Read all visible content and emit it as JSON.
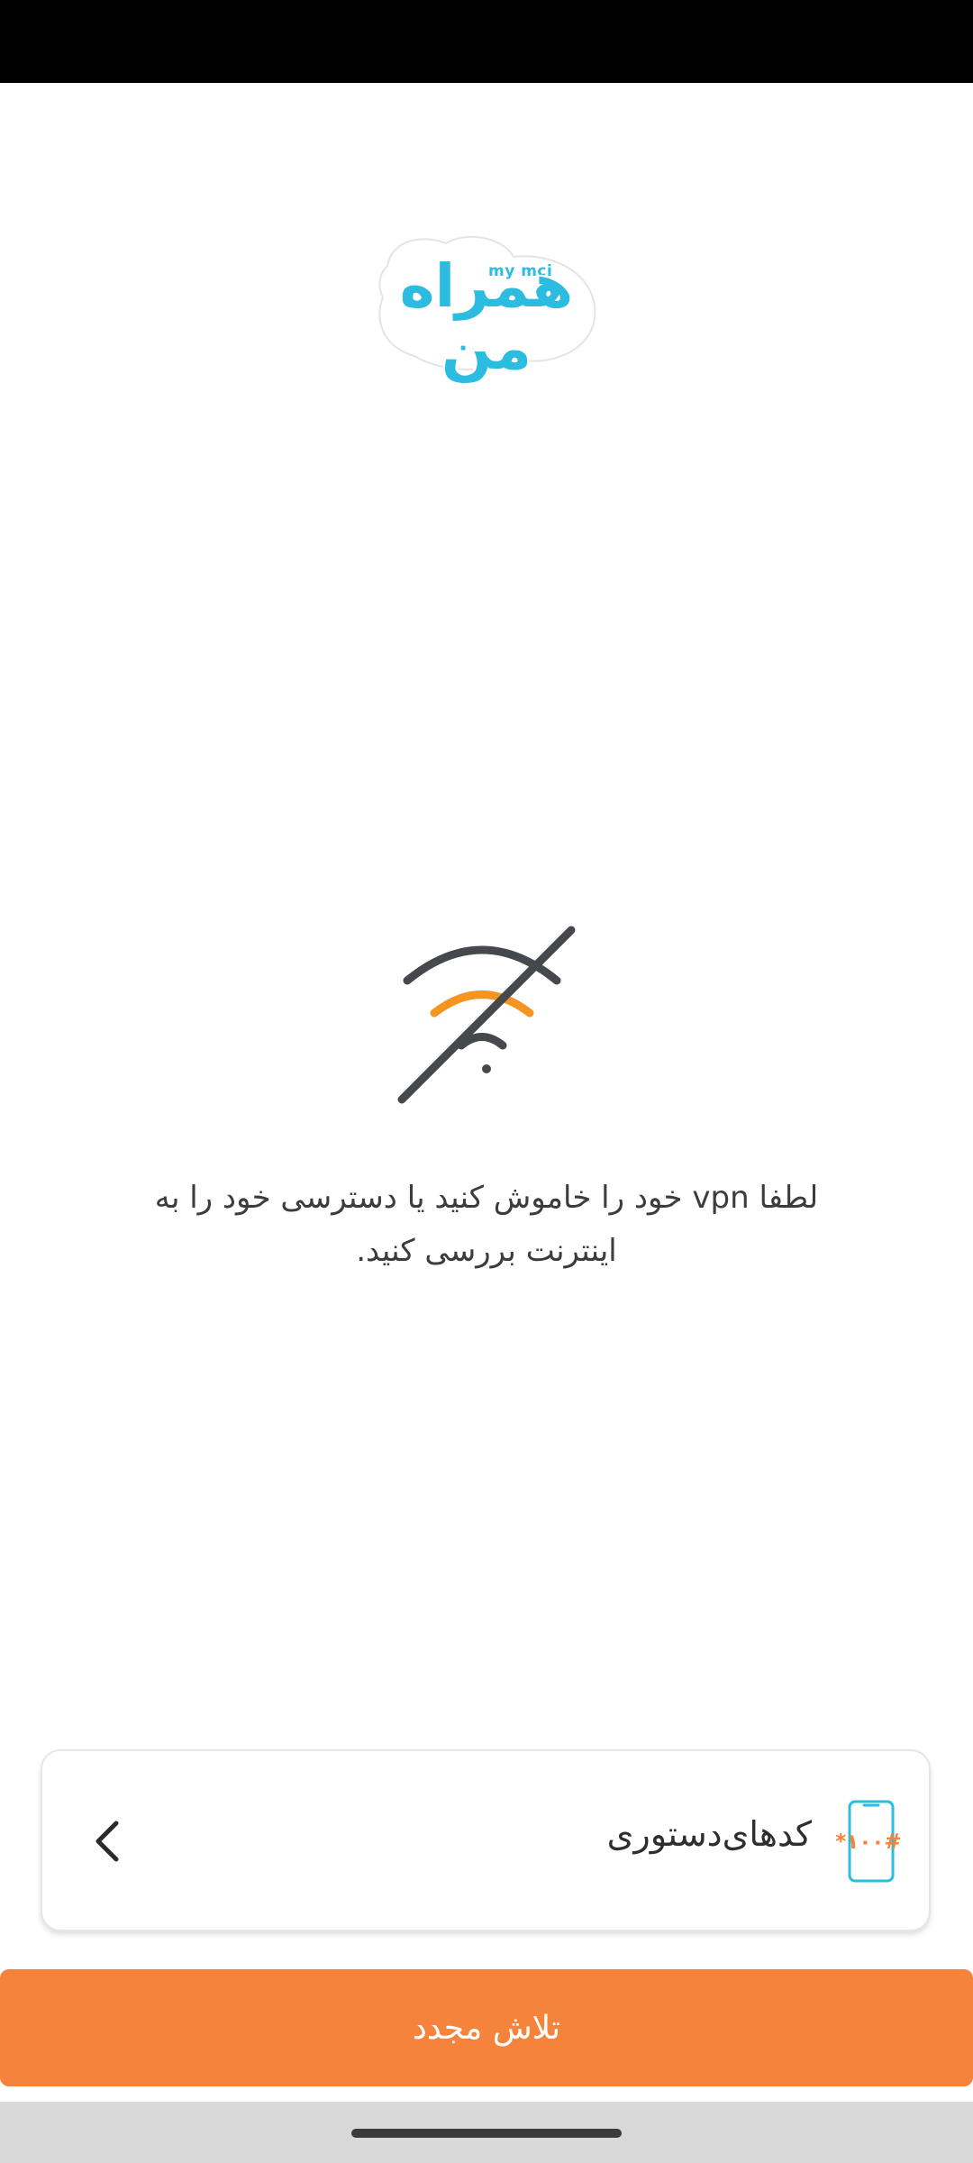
{
  "logo": {
    "main_text": "همراه من",
    "sub_text": "my mci",
    "color": "#2bbce0"
  },
  "status": {
    "icon": "no-wifi-icon",
    "message": "لطفا vpn خود را خاموش کنید یا دسترسی خود را به اینترنت بررسی کنید."
  },
  "ussd_card": {
    "label": "کدهای‌دستوری",
    "icon": "phone-ussd-icon",
    "icon_code": "*۱۰۰#",
    "arrow": "chevron-left-icon"
  },
  "retry_button": {
    "label": "تلاش مجدد",
    "color": "#f5833b"
  },
  "colors": {
    "accent_orange": "#f5833b",
    "brand_cyan": "#2bbce0",
    "icon_gray": "#45484d"
  }
}
